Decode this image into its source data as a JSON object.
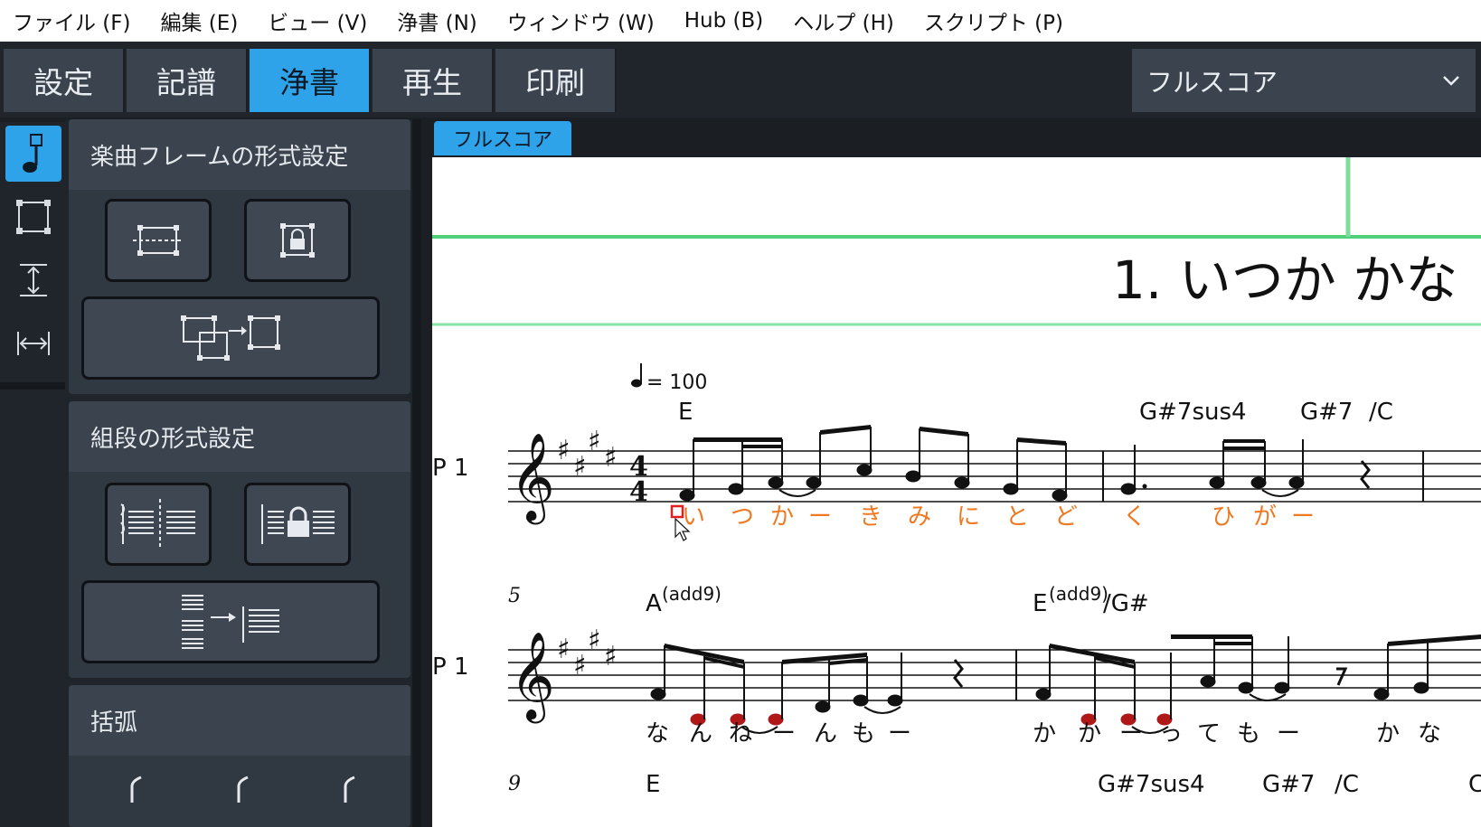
{
  "menu": [
    "ファイル (F)",
    "編集 (E)",
    "ビュー (V)",
    "浄書 (N)",
    "ウィンドウ (W)",
    "Hub (B)",
    "ヘルプ (H)",
    "スクリプト (P)"
  ],
  "modes": {
    "setup": "設定",
    "write": "記譜",
    "engrave": "浄書",
    "play": "再生",
    "print": "印刷"
  },
  "layout_select": "フルスコア",
  "panel": {
    "frame_title": "楽曲フレームの形式設定",
    "system_title": "組段の形式設定",
    "brackets_title": "括弧"
  },
  "score": {
    "tab_label": "フルスコア",
    "title": "1. いつか かな",
    "tempo": "= 100",
    "staff_label": "P 1",
    "chords_row1": [
      "E",
      "G#7sus4",
      "G#7",
      "/C"
    ],
    "chords_row2": [
      "A",
      "(add9)",
      "E",
      "(add9)",
      "/G#"
    ],
    "chords_row3": [
      "E",
      "G#7sus4",
      "G#7",
      "/C",
      "C"
    ],
    "bar_numbers": [
      "5",
      "9"
    ],
    "lyrics_row1": [
      "い",
      "つ",
      "か",
      "ー",
      "き",
      "み",
      "に",
      "と",
      "ど",
      "く",
      "ひ",
      "が",
      "ー"
    ],
    "lyrics_row2": [
      "な",
      "ん",
      "ね",
      "ー",
      "ん",
      "も",
      "ー",
      "か",
      "か",
      "ー",
      "っ",
      "て",
      "も",
      "ー",
      "か",
      "な"
    ],
    "time_sig_top": "4",
    "time_sig_bottom": "4"
  },
  "colors": {
    "accent": "#2ea3ea",
    "lyric_selected": "#f07820",
    "out_of_range_note": "#b01818",
    "frame_green": "#4fd07a"
  }
}
